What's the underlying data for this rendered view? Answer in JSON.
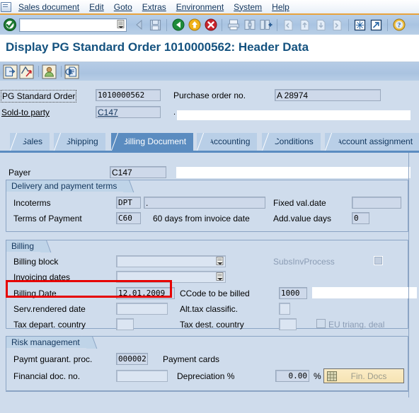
{
  "window": {
    "icon": "sap-window-icon"
  },
  "menu": {
    "items": [
      {
        "label": "Sales document",
        "accel": "S"
      },
      {
        "label": "Edit",
        "accel": "E"
      },
      {
        "label": "Goto",
        "accel": "G"
      },
      {
        "label": "Extras",
        "accel": "a"
      },
      {
        "label": "Environment",
        "accel": "n"
      },
      {
        "label": "System",
        "accel": "y"
      },
      {
        "label": "Help",
        "accel": "H"
      }
    ]
  },
  "toolbar": {
    "command_value": "",
    "command_placeholder": "",
    "buttons": [
      {
        "name": "enter-check-icon",
        "title": "Enter"
      },
      {
        "name": "back-arrow-icon",
        "title": "Back"
      },
      {
        "name": "save-icon",
        "title": "Save"
      },
      {
        "name": "back-green-icon",
        "title": "Back"
      },
      {
        "name": "exit-yellow-icon",
        "title": "Exit"
      },
      {
        "name": "cancel-red-icon",
        "title": "Cancel"
      },
      {
        "name": "print-icon",
        "title": "Print"
      },
      {
        "name": "find-icon",
        "title": "Find"
      },
      {
        "name": "find-next-icon",
        "title": "Find Next"
      },
      {
        "name": "first-page-icon",
        "title": "First page"
      },
      {
        "name": "previous-page-icon",
        "title": "Previous page"
      },
      {
        "name": "next-page-icon",
        "title": "Next page"
      },
      {
        "name": "last-page-icon",
        "title": "Last page"
      },
      {
        "name": "create-session-icon",
        "title": "Create session"
      },
      {
        "name": "create-shortcut-icon",
        "title": "Create shortcut"
      },
      {
        "name": "help-icon",
        "title": "Help"
      }
    ]
  },
  "page": {
    "title": "Display PG Standard Order 1010000562: Header Data"
  },
  "app_toolbar": {
    "buttons": [
      {
        "name": "copy-document-icon",
        "title": "Orders"
      },
      {
        "name": "document-flow-icon",
        "title": "Document flow"
      },
      {
        "name": "partner-icon",
        "title": "Partner"
      },
      {
        "name": "display-doc-header-icon",
        "title": "Display doc. header details"
      }
    ]
  },
  "header": {
    "order_label": "PG Standard Order",
    "order_value": "1010000562",
    "sold_to_label": "Sold-to party",
    "sold_to_value": "C147",
    "po_label": "Purchase order no.",
    "po_value": "A 28974",
    "sold_to_desc": "."
  },
  "tabs": [
    {
      "label": "Sales",
      "active": false
    },
    {
      "label": "Shipping",
      "active": false
    },
    {
      "label": "Billing Document",
      "active": true
    },
    {
      "label": "Accounting",
      "active": false
    },
    {
      "label": "Conditions",
      "active": false
    },
    {
      "label": "Account assignment",
      "active": false
    }
  ],
  "billing_tab": {
    "payer_label": "Payer",
    "payer_value": "C147",
    "payer_desc": "",
    "delivery_group": {
      "title": "Delivery and payment terms",
      "incoterms_label": "Incoterms",
      "incoterms_code": "DPT",
      "incoterms_desc": ".",
      "fixed_val_date_label": "Fixed val.date",
      "fixed_val_date_value": "",
      "terms_payment_label": "Terms of Payment",
      "terms_payment_code": "C60",
      "terms_payment_desc": "60 days from invoice date",
      "add_value_days_label": "Add.value days",
      "add_value_days_value": "0"
    },
    "billing_group": {
      "title": "Billing",
      "billing_block_label": "Billing block",
      "billing_block_value": "",
      "subsinv_label": "SubsInvProcess",
      "subsinv_checked": false,
      "invoicing_dates_label": "Invoicing dates",
      "invoicing_dates_value": "",
      "billing_date_label": "Billing Date",
      "billing_date_value": "12.01.2009",
      "ccode_label": "CCode to be billed",
      "ccode_value": "1000",
      "serv_rendered_label": "Serv.rendered date",
      "serv_rendered_value": "",
      "alt_tax_label": "Alt.tax classific.",
      "alt_tax_value": "",
      "tax_depart_label": "Tax depart. country",
      "tax_depart_value": "",
      "tax_dest_label": "Tax dest. country",
      "tax_dest_value": "",
      "eu_triang_label": "EU triang. deal",
      "eu_triang_checked": false
    },
    "risk_group": {
      "title": "Risk management",
      "paymt_guarant_label": "Paymt guarant. proc.",
      "paymt_guarant_value": "000002",
      "payment_cards_label": "Payment cards",
      "financial_doc_label": "Financial doc. no.",
      "financial_doc_value": "",
      "depreciation_label": "Depreciation %",
      "depreciation_value": "0.00",
      "percent_sign": "%",
      "fin_docs_button": "Fin. Docs"
    }
  },
  "annotation": {
    "highlight_color": "#e60000",
    "highlight_target": "billing-date-field"
  }
}
